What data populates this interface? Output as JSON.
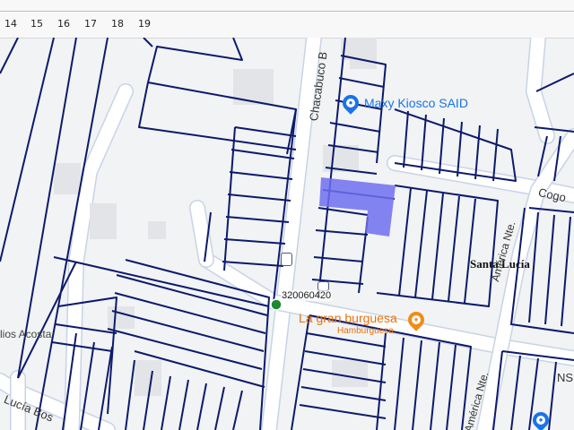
{
  "ruler": {
    "ticks": [
      "14",
      "15",
      "16",
      "17",
      "18",
      "19"
    ]
  },
  "map": {
    "streets": {
      "chacabuco": "Chacabuco B",
      "america_top": "América Nte.",
      "america_bottom": "América Nte.",
      "cogo": "Cogo",
      "lucia_bos": "Lucía Bos",
      "acosta": "lios Acosta",
      "ns": "NS"
    },
    "places": {
      "kiosco": "Maxy Kiosco SAID",
      "burguesa": "La gran burguesa",
      "burguesa_sub": "Hamburguesa"
    },
    "area_label": "Santa Lucía",
    "stop_id": "320060420",
    "colors": {
      "parcel_line": "#0d1a6b",
      "highlight": "#6e6ef0",
      "road": "#ffffff",
      "road_edge": "#c9d3e6",
      "building": "#e3e4e8",
      "poi_blue": "#1a73e8",
      "poi_orange": "#f28b17",
      "stop_green": "#1e8a2e",
      "bus_icon": "#4a5a7a"
    }
  }
}
